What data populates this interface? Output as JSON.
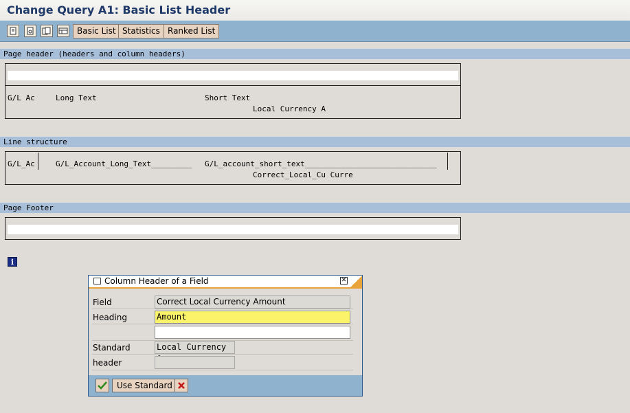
{
  "window": {
    "title": "Change Query A1: Basic List Header"
  },
  "toolbar": {
    "icons": [
      "page-icon",
      "page-settings-icon",
      "page-copy-icon",
      "layout-icon"
    ],
    "buttons": [
      "Basic List",
      "Statistics",
      "Ranked List"
    ]
  },
  "sections": {
    "page_header": {
      "title": "Page header (headers and column headers)",
      "col1": "G/L Ac",
      "col2": "Long Text",
      "col3": "Short Text",
      "col4": "Local Currency A"
    },
    "line_structure": {
      "title": "Line structure",
      "f1": "G/L_Ac",
      "f2": "G/L_Account_Long_Text_________",
      "f3": "G/L_account_short_text_____________________________",
      "f4": "Correct_Local_Cu Curre"
    },
    "page_footer": {
      "title": "Page Footer"
    }
  },
  "info_icon": "info-icon",
  "dialog": {
    "title": "Column Header of a Field",
    "field_label": "Field",
    "field_value": "Correct Local Currency Amount",
    "heading_label": "Heading",
    "heading_value": "Amount",
    "heading_value2": "",
    "standard_label": "Standard",
    "header_label": "header",
    "standard_value": "Local Currency A",
    "header_value": "",
    "footer": {
      "use_standard": "Use Standard"
    }
  },
  "colors": {
    "title": "#1f3a69",
    "toolbar": "#8fb2cf",
    "section_bar": "#a8bfd9",
    "button": "#e7d3c0",
    "heading_highlight": "#fbf36a",
    "confirm": "#2e8a1e",
    "cancel": "#c41a1a"
  }
}
